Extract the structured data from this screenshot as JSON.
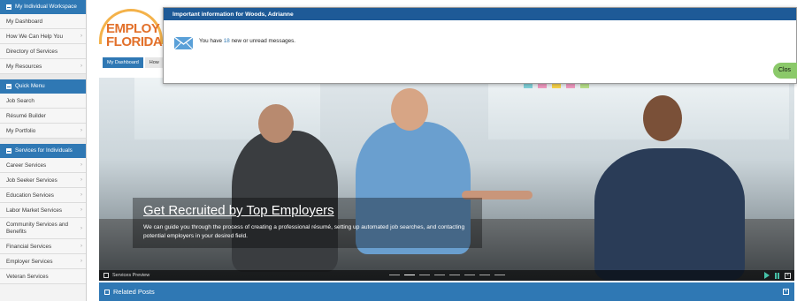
{
  "sidebar": {
    "sections": [
      {
        "title": "My Individual Workspace",
        "items": [
          {
            "label": "My Dashboard",
            "chevron": false
          },
          {
            "label": "How We Can Help You",
            "chevron": true
          },
          {
            "label": "Directory of Services",
            "chevron": false
          },
          {
            "label": "My Resources",
            "chevron": true
          }
        ]
      },
      {
        "title": "Quick Menu",
        "items": [
          {
            "label": "Job Search",
            "chevron": false
          },
          {
            "label": "Résumé Builder",
            "chevron": false
          },
          {
            "label": "My Portfolio",
            "chevron": true
          }
        ]
      },
      {
        "title": "Services for Individuals",
        "items": [
          {
            "label": "Career Services",
            "chevron": true
          },
          {
            "label": "Job Seeker Services",
            "chevron": true
          },
          {
            "label": "Education Services",
            "chevron": true
          },
          {
            "label": "Labor Market Services",
            "chevron": true
          },
          {
            "label": "Community Services and Benefits",
            "chevron": true
          },
          {
            "label": "Financial Services",
            "chevron": true
          },
          {
            "label": "Employer Services",
            "chevron": true
          },
          {
            "label": "Veteran Services",
            "chevron": false
          }
        ]
      }
    ]
  },
  "logo": {
    "line1": "EMPLOY",
    "line2": "FLORIDA"
  },
  "tabs": [
    {
      "label": "My Dashboard"
    },
    {
      "label": "How"
    }
  ],
  "hero": {
    "title": "Get Recruited by Top Employers",
    "description": "We can guide you through the process of creating a professional résumé, setting up automated job searches, and contacting potential employers in your desired field.",
    "preview_label": "Services Preview",
    "slide_count": 8,
    "active_slide": 2
  },
  "related": {
    "title": "Related Posts"
  },
  "modal": {
    "title": "Important information for Woods, Adrianne",
    "message_prefix": "You have ",
    "message_count": "18",
    "message_suffix": " new or unread messages.",
    "close_label": "Clos"
  },
  "colors": {
    "primary": "#2f78b4",
    "modal_header": "#1e5a97",
    "close_button": "#8bc96a",
    "logo_orange": "#e2702a"
  }
}
